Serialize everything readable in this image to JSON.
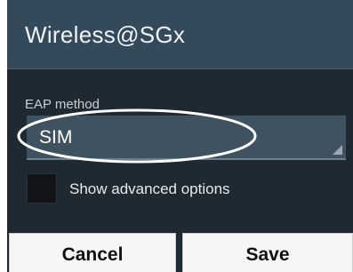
{
  "dialog": {
    "title": "Wireless@SGx",
    "eap": {
      "label": "EAP method",
      "selected": "SIM"
    },
    "advanced": {
      "label": "Show advanced options",
      "checked": false
    },
    "buttons": {
      "cancel": "Cancel",
      "save": "Save"
    }
  },
  "colors": {
    "title_bar": "#34495a",
    "dialog_bg": "#1e2932",
    "spinner_bg": "#3f525f",
    "button_bg": "#f6f6f6"
  }
}
